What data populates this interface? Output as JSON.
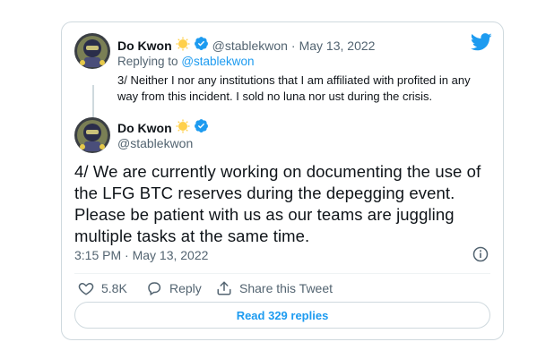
{
  "reply_tweet": {
    "author_name": "Do Kwon",
    "handle": "@stablekwon",
    "date_sep": "·",
    "date": "May 13, 2022",
    "replying_label": "Replying to",
    "replying_handle": "@stablekwon",
    "text": "3/ Neither I nor any institutions that I am affiliated with profited in any way from this incident. I sold no luna nor ust during the crisis."
  },
  "main_tweet": {
    "author_name": "Do Kwon",
    "handle": "@stablekwon",
    "text": "4/ We are currently working on documenting the use of the LFG BTC reserves during the depegging event. Please be patient with us as our teams are juggling multiple tasks at the same time.",
    "timestamp": "3:15 PM · May 13, 2022"
  },
  "actions": {
    "like_count": "5.8K",
    "reply_label": "Reply",
    "share_label": "Share this Tweet"
  },
  "read_replies_label": "Read 329 replies",
  "colors": {
    "accent": "#1d9bf0",
    "verified": "#1d9bf0",
    "gold": "#ffd04a",
    "border": "#cfd9de"
  }
}
